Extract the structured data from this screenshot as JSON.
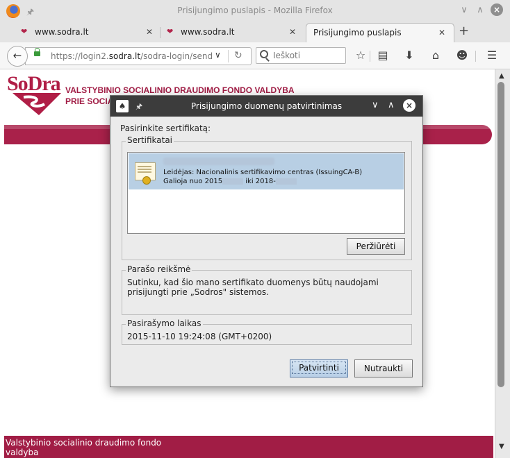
{
  "window": {
    "title": "Prisijungimo puslapis - Mozilla Firefox"
  },
  "tabs": [
    {
      "label": "www.sodra.lt"
    },
    {
      "label": "www.sodra.lt"
    },
    {
      "label": "Prisijungimo puslapis"
    }
  ],
  "navbar": {
    "url_prefix": "https://login2.",
    "url_domain": "sodra.lt",
    "url_path": "/sodra-login/send.f",
    "search_placeholder": "Ieškoti"
  },
  "page": {
    "logo": "SoDra",
    "org_line1": "VALSTYBINIO SOCIALINIO DRAUDIMO FONDO VALDYBA",
    "org_line2": "PRIE SOCIALIN",
    "footer_text": "Valstybinio socialinio draudimo fondo valdyba"
  },
  "dialog": {
    "title": "Prisijungimo duomenų patvirtinimas",
    "select_label": "Pasirinkite sertifikatą:",
    "certs_legend": "Sertifikatai",
    "cert": {
      "issuer": "Leidėjas: Nacionalinis sertifikavimo centras (IssuingCA-B)",
      "valid_prefix": "Galioja nuo 2015",
      "valid_mid": "iki 2018-"
    },
    "view_button": "Peržiūrėti",
    "signature_legend": "Parašo reikšmė",
    "signature_text": "Sutinku, kad šio mano sertifikato duomenys būtų naudojami prisijungti prie „Sodros\" sistemos.",
    "time_legend": "Pasirašymo laikas",
    "time_value": "2015-11-10 19:24:08 (GMT+0200)",
    "confirm_button": "Patvirtinti",
    "cancel_button": "Nutraukti"
  },
  "colors": {
    "brand": "#a11d45",
    "selection": "#b8cfe4",
    "dialog_titlebar": "#3c3c3c"
  }
}
